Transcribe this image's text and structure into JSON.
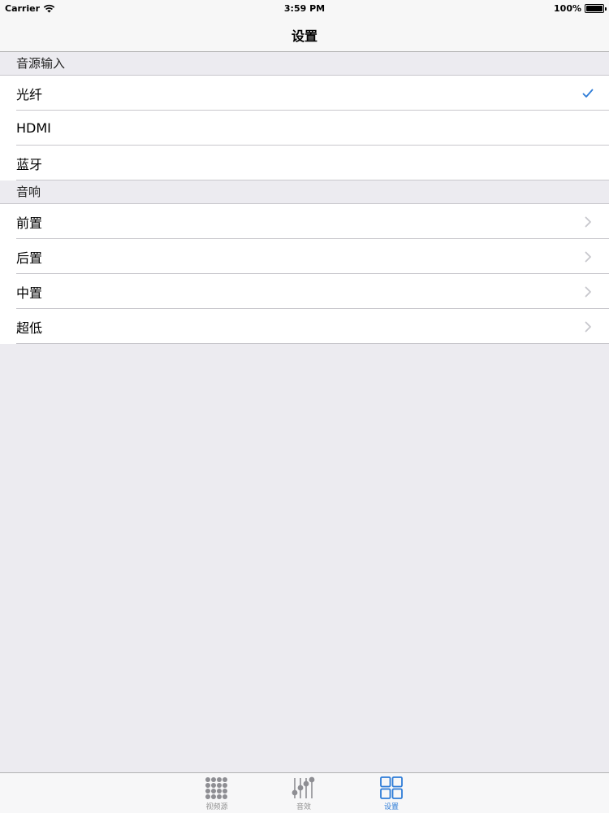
{
  "status_bar": {
    "carrier": "Carrier",
    "time": "3:59 PM",
    "battery": "100%"
  },
  "nav": {
    "title": "设置"
  },
  "sections": [
    {
      "header": "音源输入",
      "rows": [
        {
          "label": "光纤",
          "accessory": "checkmark-icon"
        },
        {
          "label": "HDMI",
          "accessory": ""
        },
        {
          "label": "蓝牙",
          "accessory": ""
        }
      ]
    },
    {
      "header": "音响",
      "rows": [
        {
          "label": "前置",
          "accessory": "chevron-right-icon"
        },
        {
          "label": "后置",
          "accessory": "chevron-right-icon"
        },
        {
          "label": "中置",
          "accessory": "chevron-right-icon"
        },
        {
          "label": "超低",
          "accessory": "chevron-right-icon"
        }
      ]
    }
  ],
  "tabbar": {
    "tabs": [
      {
        "label": "视频源",
        "icon": "dot-grid-icon",
        "active": false
      },
      {
        "label": "音效",
        "icon": "equalizer-icon",
        "active": false
      },
      {
        "label": "设置",
        "icon": "four-squares-icon",
        "active": true
      }
    ]
  },
  "colors": {
    "accent": "#2e7cd7",
    "background": "#ecebf0",
    "separator": "#c8c7cc",
    "inactive_tab": "#929292"
  }
}
